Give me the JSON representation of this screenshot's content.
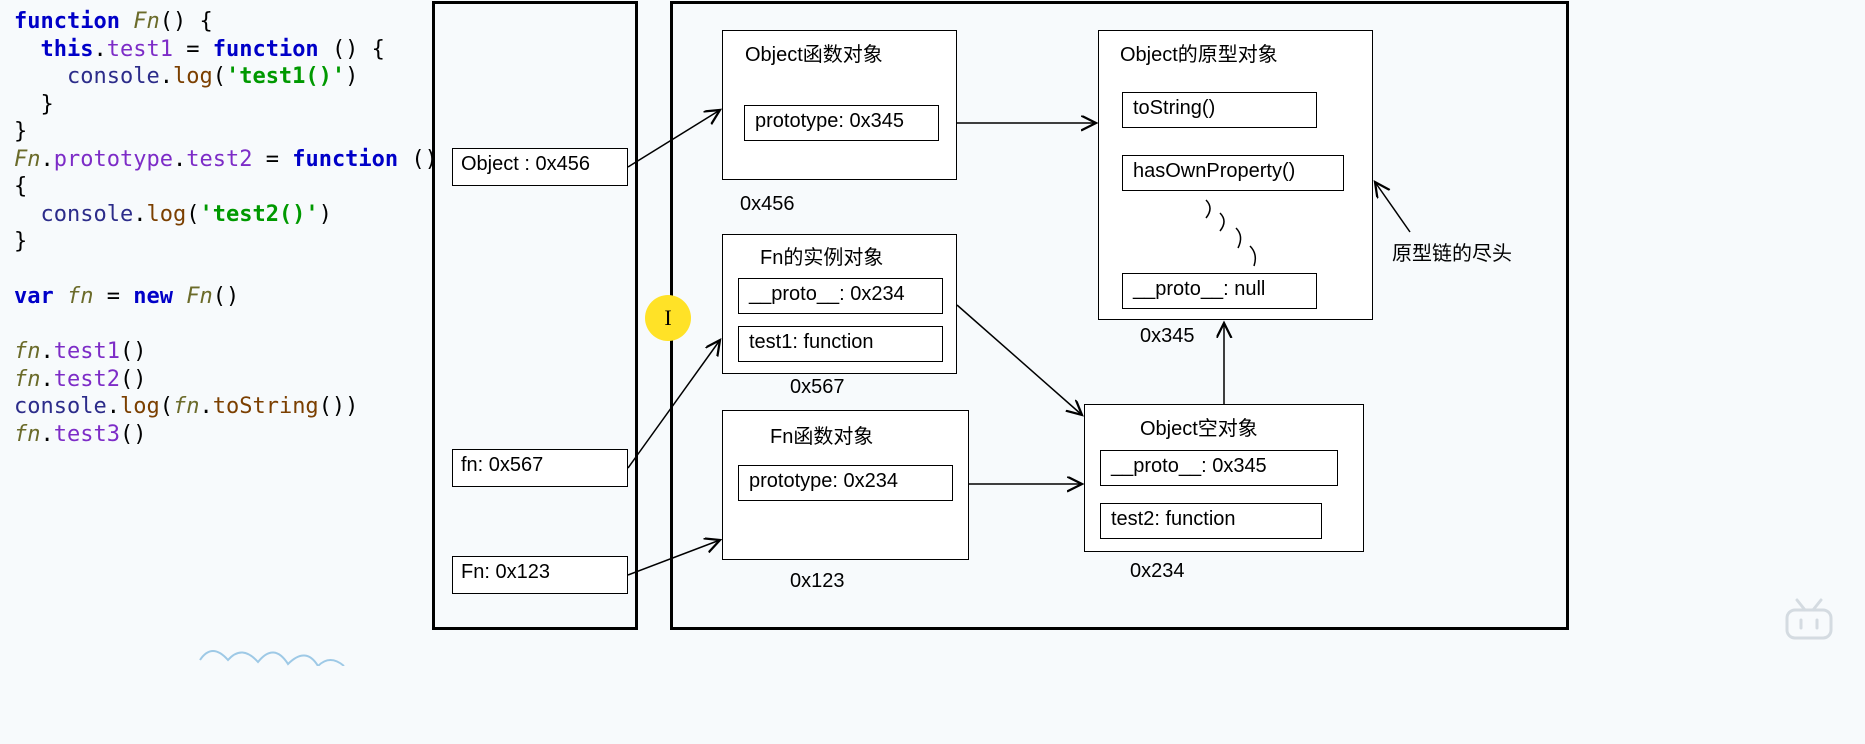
{
  "code": {
    "kw_function": "function",
    "Fn": "Fn",
    "kw_this": "this",
    "test1": "test1",
    "test2": "test2",
    "test3": "test3",
    "obj_console": "console",
    "method_log": "log",
    "str_test1": "'test1()'",
    "str_test2": "'test2()'",
    "prototype": "prototype",
    "kw_var": "var",
    "fn": "fn",
    "kw_new": "new",
    "method_toString": "toString"
  },
  "stack": {
    "object": "Object : 0x456",
    "fn": "fn: 0x567",
    "Fn": "Fn: 0x123"
  },
  "heap": {
    "objectFunc": {
      "title": "Object函数对象",
      "slot_prototype": "prototype: 0x345",
      "addr": "0x456"
    },
    "objectProto": {
      "title": "Object的原型对象",
      "slot_toString": "toString()",
      "slot_hasOwnProperty": "hasOwnProperty()",
      "slot_proto": "__proto__: null",
      "addr": "0x345"
    },
    "fnInstance": {
      "title": "Fn的实例对象",
      "slot_proto": "__proto__: 0x234",
      "slot_test1": "test1: function",
      "addr": "0x567"
    },
    "fnFunc": {
      "title": "Fn函数对象",
      "slot_prototype": "prototype: 0x234",
      "addr": "0x123"
    },
    "objectEmpty": {
      "title": "Object空对象",
      "slot_proto": "__proto__: 0x345",
      "slot_test2": "test2: function",
      "addr": "0x234"
    },
    "note_chainEnd": "原型链的尽头"
  }
}
